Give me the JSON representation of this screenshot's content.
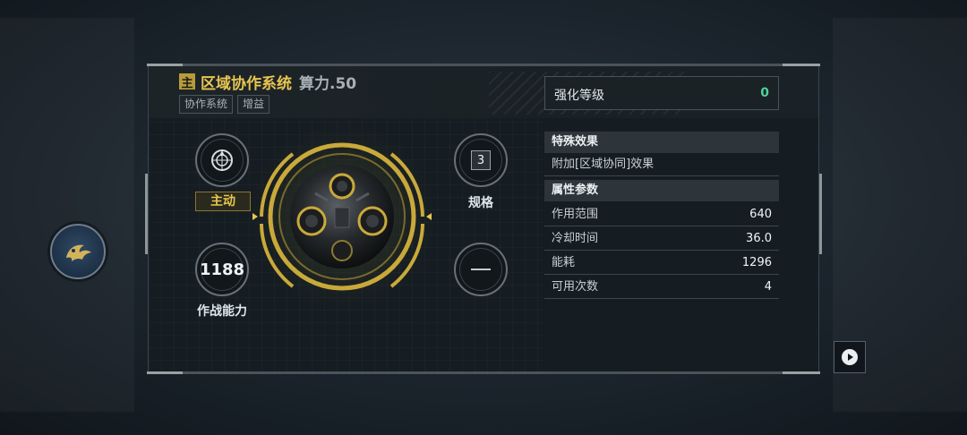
{
  "header": {
    "badge": "主",
    "title": "区域协作系统",
    "power": "算力.50",
    "tags": [
      "协作系统",
      "增益"
    ]
  },
  "slots": {
    "active_label": "主动",
    "spec_value": "3",
    "spec_label": "规格",
    "combat_value": "1188",
    "combat_label": "作战能力"
  },
  "enhance": {
    "label": "强化等级",
    "value": "0"
  },
  "special": {
    "header": "特殊效果",
    "text": "附加[区域协同]效果"
  },
  "attributes": {
    "header": "属性参数",
    "rows": [
      {
        "label": "作用范围",
        "value": "640"
      },
      {
        "label": "冷却时间",
        "value": "36.0"
      },
      {
        "label": "能耗",
        "value": "1296"
      },
      {
        "label": "可用次数",
        "value": "4"
      }
    ]
  },
  "icons": {
    "active_skill": "target-emblem-icon",
    "side_button": "phoenix-emblem-icon",
    "play_button": "play-icon"
  },
  "colors": {
    "gold": "#e8c650",
    "green_value": "#4fd29c"
  }
}
